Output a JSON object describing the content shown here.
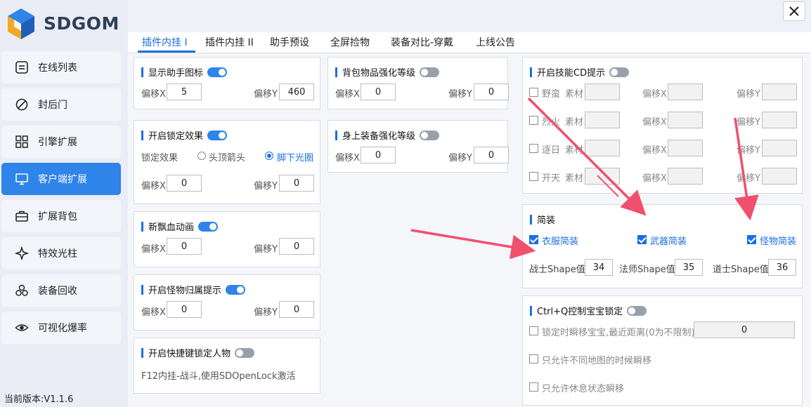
{
  "app": {
    "logo_text": "SDGOM",
    "version": "当前版本:V1.1.6"
  },
  "colors": {
    "accent": "#2e84e8",
    "tab_active": "#1b6fe0",
    "arrow": "#f0506e"
  },
  "sidebar": {
    "items": [
      {
        "label": "在线列表",
        "icon": "list-icon"
      },
      {
        "label": "封后门",
        "icon": "ban-icon"
      },
      {
        "label": "引擎扩展",
        "icon": "grid-icon"
      },
      {
        "label": "客户端扩展",
        "icon": "monitor-icon",
        "active": true
      },
      {
        "label": "扩展背包",
        "icon": "briefcase-icon"
      },
      {
        "label": "特效光柱",
        "icon": "sparkle-icon"
      },
      {
        "label": "装备回收",
        "icon": "recycle-icon"
      },
      {
        "label": "可视化爆率",
        "icon": "eye-icon"
      }
    ]
  },
  "tabs": [
    "插件内挂 I",
    "插件内挂 II",
    "助手预设",
    "全屏捡物",
    "装备对比-穿戴",
    "上线公告"
  ],
  "labels": {
    "offset_x": "偏移X",
    "offset_y": "偏移Y",
    "material": "素材"
  },
  "cards": {
    "helper_icon": {
      "title": "显示助手图标",
      "x": "5",
      "y": "460"
    },
    "lock_effect": {
      "title": "开启锁定效果",
      "effect_label": "锁定效果",
      "option_head": "头顶箭头",
      "option_foot": "脚下光圈",
      "x": "0",
      "y": "0"
    },
    "blood_anim": {
      "title": "新飘血动画",
      "x": "0",
      "y": "0"
    },
    "monster_owner": {
      "title": "开启怪物归属提示",
      "x": "0",
      "y": "0"
    },
    "hotkey_lock": {
      "title": "开启快捷键锁定人物",
      "desc": "F12内挂-战斗,使用SDOpenLock激活"
    },
    "bag_strength": {
      "title": "背包物品强化等级",
      "x": "0",
      "y": "0"
    },
    "equip_strength": {
      "title": "身上装备强化等级",
      "x": "0",
      "y": "0"
    },
    "skill_cd": {
      "title": "开启技能CD提示",
      "skills": [
        "野蛮",
        "烈火",
        "逐日",
        "开天"
      ]
    },
    "simple": {
      "title": "简装",
      "cloth": "衣服简装",
      "weapon": "武器简装",
      "monster": "怪物简装",
      "warrior_label": "战士Shape值",
      "warrior_value": "34",
      "mage_label": "法师Shape值",
      "mage_value": "35",
      "taoist_label": "道士Shape值",
      "taoist_value": "36"
    },
    "pet_lock": {
      "title": "Ctrl+Q控制宝宝锁定",
      "teleport_label": "锁定时瞬移宝宝,最近距离(0为不限制)",
      "teleport_value": "0",
      "diff_map": "只允许不同地图的时候瞬移",
      "rest_only": "只允许休息状态瞬移"
    }
  }
}
